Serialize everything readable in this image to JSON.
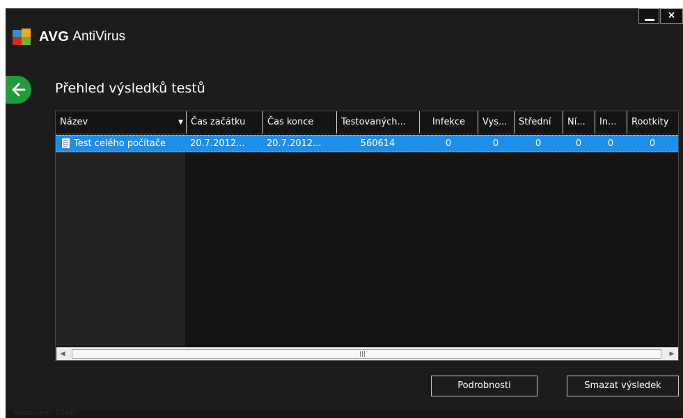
{
  "app": {
    "brand": "AVG",
    "product": "AntiVirus"
  },
  "window_controls": {
    "close_label": "×"
  },
  "page_title": "Přehled výsledků testů",
  "table": {
    "columns": [
      {
        "label": "Název"
      },
      {
        "label": "Čas začátku"
      },
      {
        "label": "Čas konce"
      },
      {
        "label": "Testovaných..."
      },
      {
        "label": "Infekce"
      },
      {
        "label": "Vys..."
      },
      {
        "label": "Střední"
      },
      {
        "label": "Ní..."
      },
      {
        "label": "In..."
      },
      {
        "label": "Rootkity"
      }
    ],
    "rows": [
      {
        "name": "Test celého počítače",
        "start": "20.7.2012...",
        "end": "20.7.2012...",
        "tested": "560614",
        "infections": "0",
        "high": "0",
        "medium": "0",
        "low": "0",
        "info": "0",
        "rootkits": "0",
        "selected": true
      }
    ],
    "scrollbar_grip": "III"
  },
  "buttons": {
    "details": "Podrobnosti",
    "delete": "Smazat výsledek"
  },
  "footer": {
    "build": "sestavení: 2580"
  },
  "colors": {
    "background": "#1b1c1e",
    "selection": "#1d8fe8",
    "back_button": "#1f9d3c"
  },
  "icons": {
    "back": "arrow-left-icon",
    "file": "document-icon",
    "sort": "sort-down-icon"
  }
}
